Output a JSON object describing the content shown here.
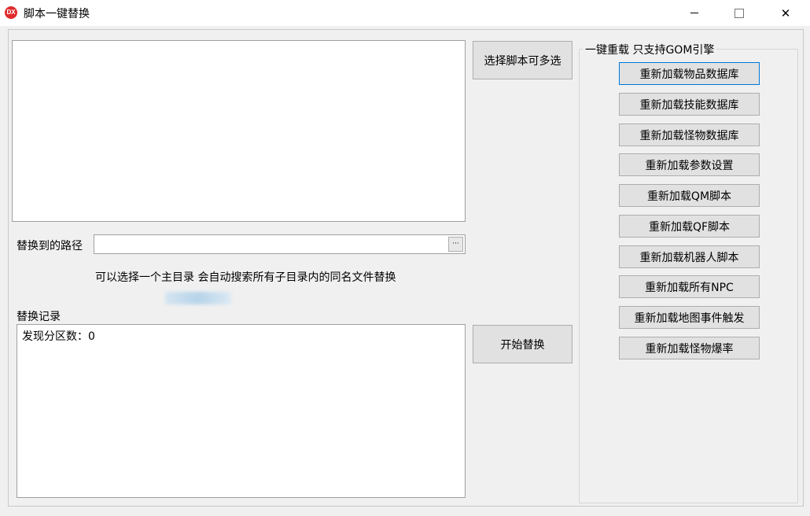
{
  "window": {
    "title": "脚本一键替换",
    "icon_label": "DX",
    "close_glyph": "✕"
  },
  "main": {
    "select_button": "选择脚本可多选",
    "path_label": "替换到的路径",
    "path_value": "",
    "browse_label": "···",
    "hint": "可以选择一个主目录 会自动搜索所有子目录内的同名文件替换",
    "log_label": "替换记录",
    "log_text": "发现分区数：0",
    "start_button": "开始替换"
  },
  "reload": {
    "caption": "一键重载 只支持GOM引擎",
    "buttons": [
      "重新加载物品数据库",
      "重新加载技能数据库",
      "重新加载怪物数据库",
      "重新加载参数设置",
      "重新加载QM脚本",
      "重新加载QF脚本",
      "重新加载机器人脚本",
      "重新加载所有NPC",
      "重新加载地图事件触发",
      "重新加载怪物爆率"
    ]
  },
  "colors": {
    "app_icon": "#e02b2b",
    "focus_border": "#0078d7"
  }
}
